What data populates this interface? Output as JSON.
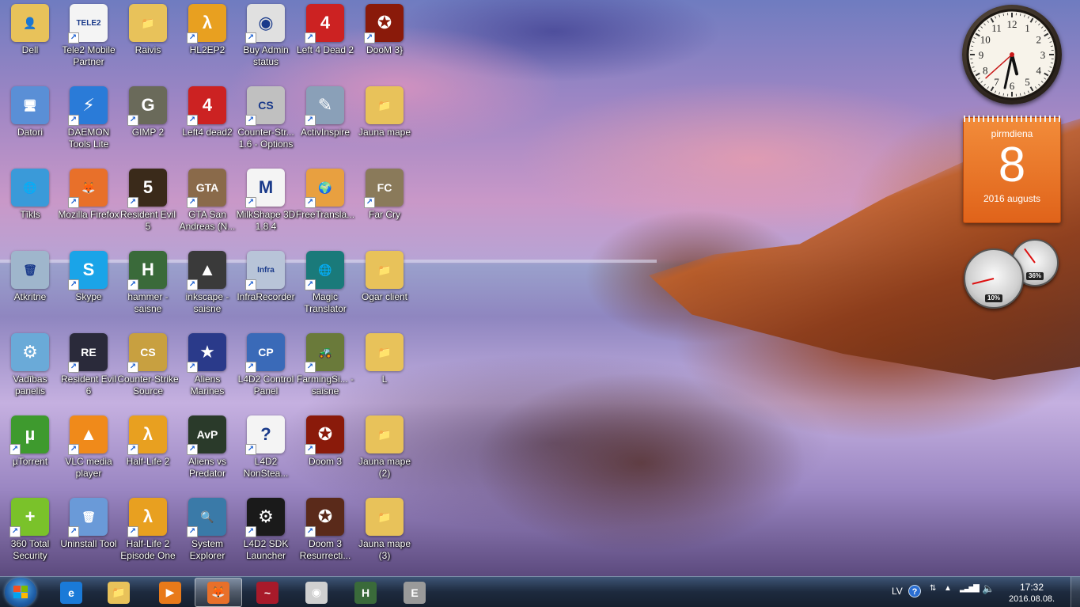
{
  "desktop": {
    "icons": [
      {
        "label": "Dell",
        "icon": "folder-user-icon",
        "color": "#e8c25a",
        "glyph": "👤"
      },
      {
        "label": "Datori",
        "icon": "computer-icon",
        "color": "#5a8fd6",
        "glyph": "🖥"
      },
      {
        "label": "Tīkls",
        "icon": "network-globe-icon",
        "color": "#3a9ad9",
        "glyph": "🌐"
      },
      {
        "label": "Atkritne",
        "icon": "recycle-bin-icon",
        "color": "#9fb6cc",
        "glyph": "🗑"
      },
      {
        "label": "Vadības panelis",
        "icon": "control-panel-icon",
        "color": "#6aaad8",
        "glyph": "⚙"
      },
      {
        "label": "µTorrent",
        "icon": "utorrent-icon",
        "color": "#3e9a2e",
        "glyph": "µ"
      },
      {
        "label": "360 Total Security",
        "icon": "360-security-icon",
        "color": "#7ac22a",
        "glyph": "+"
      },
      {
        "label": "Tele2 Mobile Partner",
        "icon": "tele2-icon",
        "color": "#f4f4f4",
        "glyph": "TELE2"
      },
      {
        "label": "DAEMON Tools Lite",
        "icon": "daemon-tools-icon",
        "color": "#2a7bd8",
        "glyph": "⚡"
      },
      {
        "label": "Mozilla Firefox",
        "icon": "firefox-icon",
        "color": "#e8702a",
        "glyph": "🦊"
      },
      {
        "label": "Skype",
        "icon": "skype-icon",
        "color": "#1aa4e8",
        "glyph": "S"
      },
      {
        "label": "Resident Evil 6",
        "icon": "resident-evil-6-icon",
        "color": "#2a2a3a",
        "glyph": "RE"
      },
      {
        "label": "VLC media player",
        "icon": "vlc-icon",
        "color": "#f08a1a",
        "glyph": "▲"
      },
      {
        "label": "Uninstall Tool",
        "icon": "uninstall-tool-icon",
        "color": "#6a9ad8",
        "glyph": "🗑"
      },
      {
        "label": "Raivis",
        "icon": "folder-icon",
        "color": "#e8c25a",
        "glyph": "📁"
      },
      {
        "label": "GIMP 2",
        "icon": "gimp-icon",
        "color": "#6a6a5a",
        "glyph": "G"
      },
      {
        "label": "Resident Evil 5",
        "icon": "resident-evil-5-icon",
        "color": "#3a2a1a",
        "glyph": "5"
      },
      {
        "label": "hammer - saisne",
        "icon": "hammer-editor-icon",
        "color": "#3a6a3a",
        "glyph": "H"
      },
      {
        "label": "Counter-Strike Source",
        "icon": "counter-strike-source-icon",
        "color": "#c8a040",
        "glyph": "CS"
      },
      {
        "label": "Half-Life 2",
        "icon": "half-life-2-icon",
        "color": "#e8a020",
        "glyph": "λ"
      },
      {
        "label": "Half-Life 2 Episode One",
        "icon": "half-life-2-ep1-icon",
        "color": "#e8a020",
        "glyph": "λ"
      },
      {
        "label": "HL2EP2",
        "icon": "hl2ep2-icon",
        "color": "#e8a020",
        "glyph": "λ"
      },
      {
        "label": "Left4 dead2",
        "icon": "left4dead2-icon",
        "color": "#cc2222",
        "glyph": "4"
      },
      {
        "label": "GTA San Andreas (N...",
        "icon": "gta-sa-icon",
        "color": "#8a6a4a",
        "glyph": "GTA"
      },
      {
        "label": "inkscape - saisne",
        "icon": "inkscape-icon",
        "color": "#3a3a3a",
        "glyph": "▲"
      },
      {
        "label": "Aliens Marines",
        "icon": "aliens-marines-icon",
        "color": "#2a3a8a",
        "glyph": "★"
      },
      {
        "label": "Aliens vs Predator",
        "icon": "aliens-vs-predator-icon",
        "color": "#2a3a2a",
        "glyph": "AvP"
      },
      {
        "label": "System Explorer",
        "icon": "system-explorer-icon",
        "color": "#3a7aa8",
        "glyph": "🔍"
      },
      {
        "label": "Buy Admin status",
        "icon": "chrome-icon",
        "color": "#e0e0e0",
        "glyph": "◉"
      },
      {
        "label": "Counter-Str... 1.6 - Options",
        "icon": "counter-strike-16-icon",
        "color": "#c0c0c0",
        "glyph": "CS"
      },
      {
        "label": "MilkShape 3D 1.8.4",
        "icon": "milkshape-icon",
        "color": "#f4f4f4",
        "glyph": "M"
      },
      {
        "label": "InfraRecorder",
        "icon": "infrarecorder-icon",
        "color": "#b8c4d8",
        "glyph": "Infra"
      },
      {
        "label": "L4D2 Control Panel",
        "icon": "l4d2-control-panel-icon",
        "color": "#3a6ab8",
        "glyph": "CP"
      },
      {
        "label": "L4D2 NonStea...",
        "icon": "l4d2-nonsteam-icon",
        "color": "#f4f4f4",
        "glyph": "?"
      },
      {
        "label": "L4D2 SDK Launcher",
        "icon": "steam-icon",
        "color": "#1a1a1a",
        "glyph": "⚙"
      },
      {
        "label": "Left 4 Dead 2",
        "icon": "left-4-dead-2-icon",
        "color": "#cc2222",
        "glyph": "4"
      },
      {
        "label": "ActivInspire",
        "icon": "activinspire-icon",
        "color": "#8aa0b8",
        "glyph": "✎"
      },
      {
        "label": "FreeTransla...",
        "icon": "free-translator-icon",
        "color": "#e8a040",
        "glyph": "🌍"
      },
      {
        "label": "Magic Translator",
        "icon": "magic-translator-icon",
        "color": "#1a7a7a",
        "glyph": "🌐"
      },
      {
        "label": "FarmingSi... - saisne",
        "icon": "farming-simulator-icon",
        "color": "#6a7a3a",
        "glyph": "🚜"
      },
      {
        "label": "Doom 3",
        "icon": "doom3-icon",
        "color": "#8a1a0a",
        "glyph": "✪"
      },
      {
        "label": "Doom 3 Resurrecti...",
        "icon": "doom3-resurrection-icon",
        "color": "#5a2a1a",
        "glyph": "✪"
      },
      {
        "label": "DooM 3}",
        "icon": "doom3-pentagram-icon",
        "color": "#8a1a0a",
        "glyph": "✪"
      },
      {
        "label": "Jauna mape",
        "icon": "folder-icon",
        "color": "#e8c25a",
        "glyph": "📁"
      },
      {
        "label": "Far Cry",
        "icon": "far-cry-icon",
        "color": "#8a7a5a",
        "glyph": "FC"
      },
      {
        "label": "Ogar client",
        "icon": "folder-icon",
        "color": "#e8c25a",
        "glyph": "📁"
      },
      {
        "label": "L",
        "icon": "folder-icon",
        "color": "#e8c25a",
        "glyph": "📁"
      },
      {
        "label": "Jauna mape (2)",
        "icon": "folder-icon",
        "color": "#e8c25a",
        "glyph": "📁"
      },
      {
        "label": "Jauna mape (3)",
        "icon": "folder-icon",
        "color": "#e8c25a",
        "glyph": "📁"
      }
    ]
  },
  "gadgets": {
    "clock": {
      "hour": 5,
      "minute": 32,
      "second": 38,
      "numbers": [
        "12",
        "1",
        "2",
        "3",
        "4",
        "5",
        "6",
        "7",
        "8",
        "9",
        "10",
        "11"
      ]
    },
    "calendar": {
      "weekday": "pirmdiena",
      "day": "8",
      "month_year": "2016 augusts"
    },
    "meters": {
      "cpu_percent": "10%",
      "memory_percent": "36%",
      "cpu_value": 0.1,
      "memory_value": 0.36
    }
  },
  "taskbar": {
    "pinned": [
      {
        "name": "internet-explorer-icon",
        "glyph": "e",
        "color": "#1a7ad8",
        "active": false
      },
      {
        "name": "file-explorer-icon",
        "glyph": "📁",
        "color": "#e8c25a",
        "active": false
      },
      {
        "name": "media-player-icon",
        "glyph": "▶",
        "color": "#e87a1a",
        "active": false
      },
      {
        "name": "firefox-icon",
        "glyph": "🦊",
        "color": "#e8702a",
        "active": true
      },
      {
        "name": "app-tilde-icon",
        "glyph": "~",
        "color": "#a81a2a",
        "active": false
      },
      {
        "name": "chrome-icon",
        "glyph": "◉",
        "color": "#d0d0d0",
        "active": false
      },
      {
        "name": "hammer-editor-icon",
        "glyph": "H",
        "color": "#3a6a3a",
        "active": false
      },
      {
        "name": "e-app-icon",
        "glyph": "E",
        "color": "#9a9a9a",
        "active": false
      }
    ],
    "tray": {
      "language": "LV",
      "help": "?",
      "time": "17:32",
      "date": "2016.08.08."
    }
  }
}
